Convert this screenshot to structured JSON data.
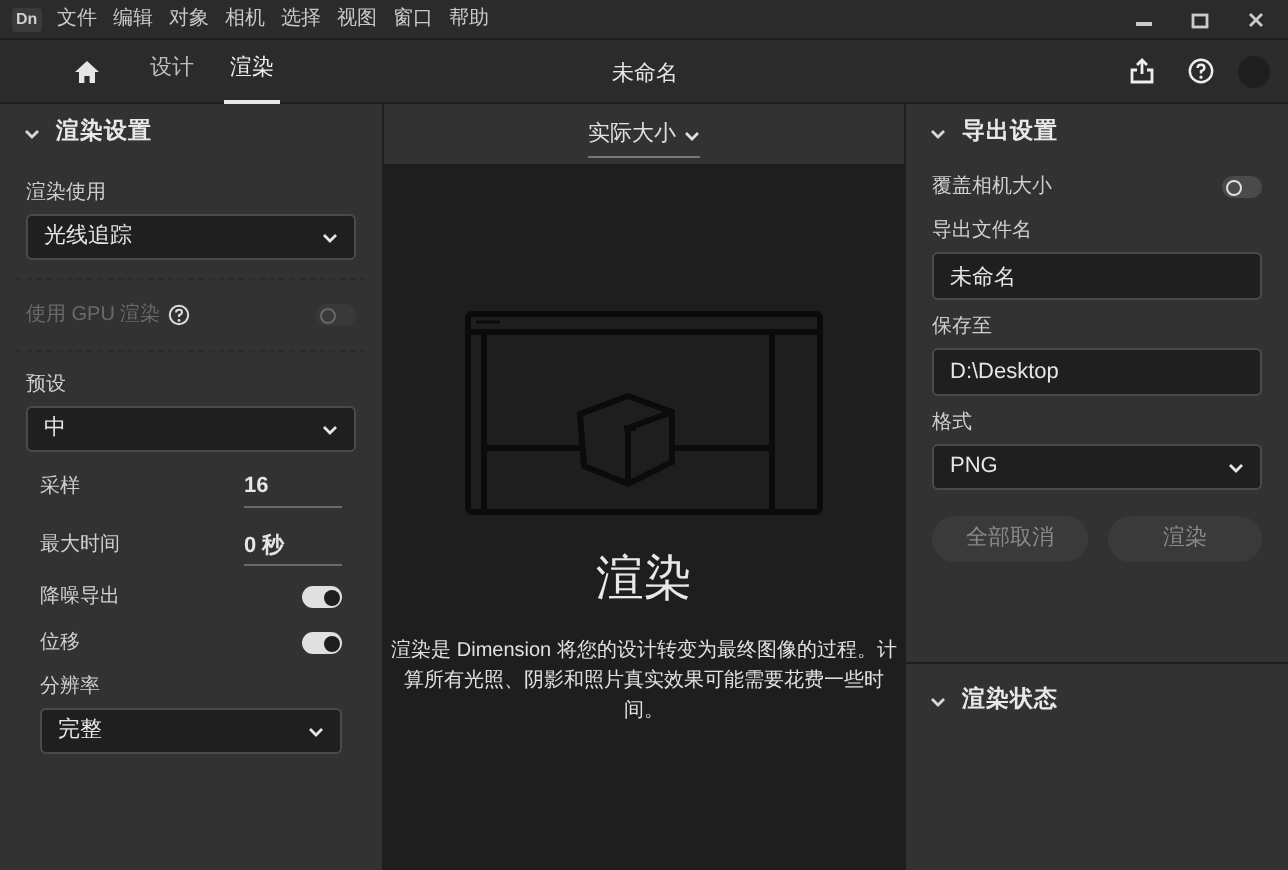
{
  "app_badge": "Dn",
  "menu": [
    "文件",
    "编辑",
    "对象",
    "相机",
    "选择",
    "视图",
    "窗口",
    "帮助"
  ],
  "tabs": [
    {
      "label": "设计",
      "selected": false
    },
    {
      "label": "渲染",
      "selected": true
    }
  ],
  "document_title": "未命名",
  "render_settings": {
    "title": "渲染设置",
    "expanded": true,
    "items": [
      {
        "kind": "select",
        "label": "渲染使用",
        "value": "光线追踪"
      },
      {
        "kind": "toggle",
        "label": "使用 GPU 渲染",
        "on": false,
        "disabled": true,
        "help": true
      },
      {
        "kind": "select",
        "label": "预设",
        "value": "中",
        "children": [
          {
            "kind": "number",
            "label": "采样",
            "value": "16"
          },
          {
            "kind": "number",
            "label": "最大时间",
            "value": "0 秒"
          },
          {
            "kind": "toggle",
            "label": "降噪导出",
            "on": true,
            "disabled": false
          },
          {
            "kind": "toggle",
            "label": "位移",
            "on": true,
            "disabled": false
          },
          {
            "kind": "select",
            "label": "分辨率",
            "value": "完整"
          }
        ]
      }
    ]
  },
  "canvas": {
    "zoom": "实际大小",
    "heading": "渲染",
    "description": "渲染是 Dimension 将您的设计转变为最终图像的过程。计算所有光照、阴影和照片真实效果可能需要花费一些时间。"
  },
  "export_settings": {
    "title": "导出设置",
    "expanded": true,
    "items": [
      {
        "kind": "toggle",
        "label": "覆盖相机大小",
        "on": false,
        "disabled": false
      },
      {
        "kind": "text",
        "label": "导出文件名",
        "value": "未命名"
      },
      {
        "kind": "text",
        "label": "保存至",
        "value": "D:\\Desktop"
      },
      {
        "kind": "select",
        "label": "格式",
        "value": "PNG"
      }
    ],
    "buttons": [
      {
        "label": "全部取消",
        "disabled": true
      },
      {
        "label": "渲染",
        "disabled": true
      }
    ]
  },
  "render_status": {
    "title": "渲染状态",
    "expanded": true
  }
}
